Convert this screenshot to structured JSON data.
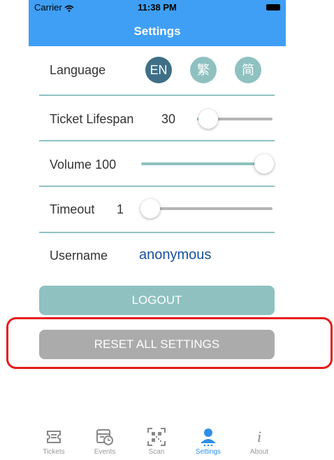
{
  "status": {
    "carrier": "Carrier",
    "time": "11:38 PM"
  },
  "nav": {
    "title": "Settings"
  },
  "settings": {
    "language": {
      "label": "Language",
      "options": [
        {
          "text": "EN",
          "selected": true
        },
        {
          "text": "繁",
          "selected": false
        },
        {
          "text": "简",
          "selected": false
        }
      ]
    },
    "ticket_lifespan": {
      "label": "Ticket Lifespan",
      "value": "30"
    },
    "volume": {
      "label": "Volume",
      "value": "100"
    },
    "timeout": {
      "label": "Timeout",
      "value": "1"
    },
    "username": {
      "label": "Username",
      "value": "anonymous"
    }
  },
  "buttons": {
    "logout": "LOGOUT",
    "reset": "RESET ALL SETTINGS"
  },
  "tabbar": {
    "tabs": [
      {
        "label": "Tickets",
        "icon": "ticket-icon",
        "active": false
      },
      {
        "label": "Events",
        "icon": "calendar-clock-icon",
        "active": false
      },
      {
        "label": "Scan",
        "icon": "qr-code-icon",
        "active": false
      },
      {
        "label": "Settings",
        "icon": "person-icon",
        "active": true
      },
      {
        "label": "About",
        "icon": "info-icon",
        "active": false
      }
    ]
  },
  "colors": {
    "nav": "#3f9ff5",
    "teal": "#8fc1c1",
    "lang_selected": "#3e6f87",
    "lang_unselected": "#8fc1c1",
    "reset_button": "#ababab",
    "username_value": "#1a4fa0",
    "highlight": "#e51b1b"
  }
}
